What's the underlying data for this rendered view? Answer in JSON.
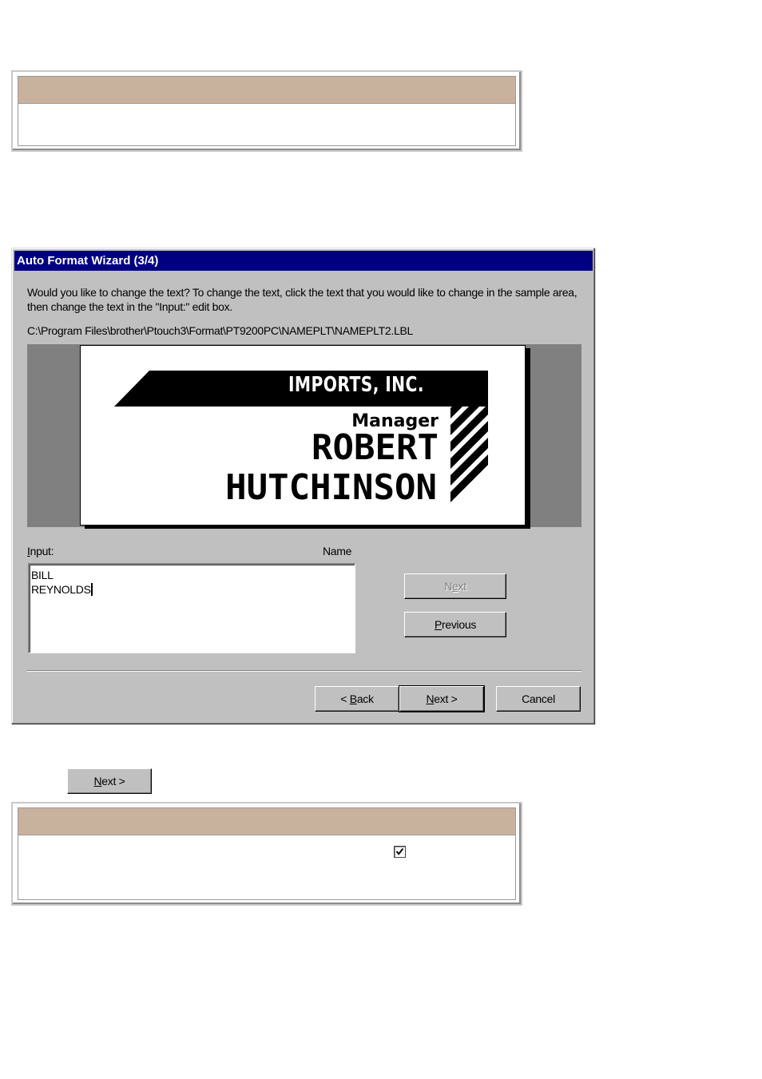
{
  "dialog": {
    "title": "Auto Format Wizard (3/4)",
    "instructions": "Would you like to change the text? To change the text, click the text that you would like to change in the sample area, then change the text in the \"Input:\" edit box.",
    "file_path": "C:\\Program Files\\brother\\Ptouch3\\Format\\PT9200PC\\NAMEPLT\\NAMEPLT2.LBL",
    "sample_label": {
      "company": "IMPORTS, INC.",
      "role": "Manager",
      "first_name": "ROBERT",
      "last_name": "HUTCHINSON"
    },
    "input_label": "Input:",
    "field_name": "Name",
    "input_value": "BILL\nREYNOLDS",
    "field_next_label": "Next",
    "field_previous_label": "Previous",
    "back_label": "< Back",
    "next_label": "Next >",
    "cancel_label": "Cancel"
  },
  "outside_next_label": "Next >",
  "bottom_note": {
    "checkbox_checked": true
  },
  "colors": {
    "titlebar": "#000080",
    "note_header": "#c8b29e",
    "dialog_face": "#c0c0c0"
  }
}
